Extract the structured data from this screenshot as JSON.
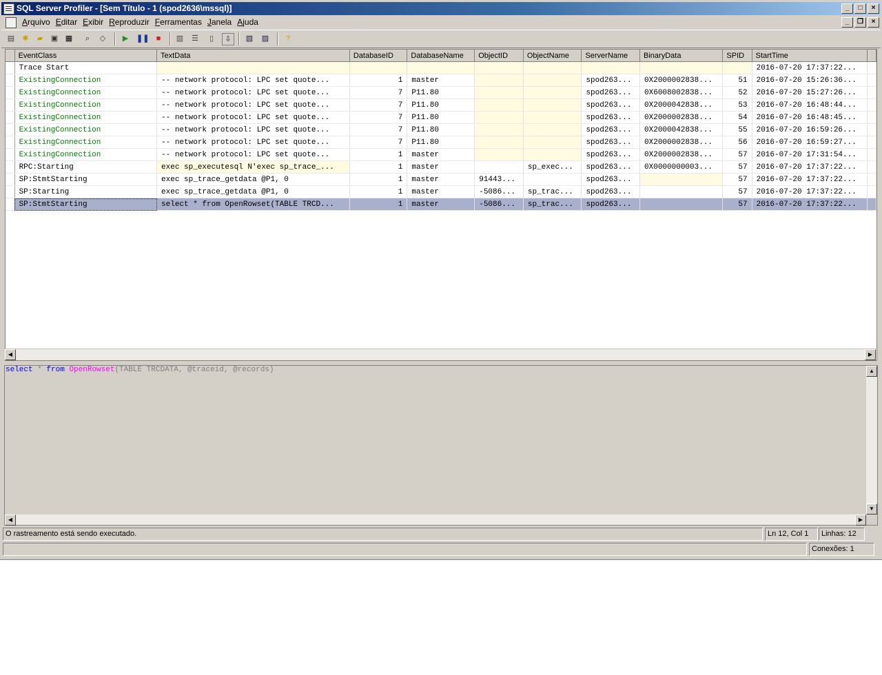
{
  "window": {
    "title": "SQL Server Profiler - [Sem Título - 1 (spod2636\\mssql)]"
  },
  "menu": {
    "items": [
      {
        "label": "Arquivo",
        "key": "A",
        "rest": "rquivo"
      },
      {
        "label": "Editar",
        "key": "E",
        "rest": "ditar"
      },
      {
        "label": "Exibir",
        "key": "E",
        "rest": "xibir"
      },
      {
        "label": "Reproduzir",
        "key": "R",
        "rest": "eproduzir"
      },
      {
        "label": "Ferramentas",
        "key": "F",
        "rest": "erramentas"
      },
      {
        "label": "Janela",
        "key": "J",
        "rest": "anela"
      },
      {
        "label": "Ajuda",
        "key": "A",
        "rest": "juda"
      }
    ]
  },
  "grid": {
    "columns": [
      "EventClass",
      "TextData",
      "DatabaseID",
      "DatabaseName",
      "ObjectID",
      "ObjectName",
      "ServerName",
      "BinaryData",
      "SPID",
      "StartTime"
    ],
    "rows": [
      [
        "Trace Start",
        "",
        "",
        "",
        "",
        "",
        "",
        "",
        "",
        "2016-07-20 17:37:22..."
      ],
      [
        "ExistingConnection",
        "-- network protocol: LPC  set quote...",
        "1",
        "master",
        "",
        "",
        "spod263...",
        "0X2000002838...",
        "51",
        "2016-07-20 15:26:36..."
      ],
      [
        "ExistingConnection",
        "-- network protocol: LPC  set quote...",
        "7",
        "P11.80",
        "",
        "",
        "spod263...",
        "0X6008002838...",
        "52",
        "2016-07-20 15:27:26..."
      ],
      [
        "ExistingConnection",
        "-- network protocol: LPC  set quote...",
        "7",
        "P11.80",
        "",
        "",
        "spod263...",
        "0X2000042838...",
        "53",
        "2016-07-20 16:48:44..."
      ],
      [
        "ExistingConnection",
        "-- network protocol: LPC  set quote...",
        "7",
        "P11.80",
        "",
        "",
        "spod263...",
        "0X2000002838...",
        "54",
        "2016-07-20 16:48:45..."
      ],
      [
        "ExistingConnection",
        "-- network protocol: LPC  set quote...",
        "7",
        "P11.80",
        "",
        "",
        "spod263...",
        "0X2000042838...",
        "55",
        "2016-07-20 16:59:26..."
      ],
      [
        "ExistingConnection",
        "-- network protocol: LPC  set quote...",
        "7",
        "P11.80",
        "",
        "",
        "spod263...",
        "0X2000002838...",
        "56",
        "2016-07-20 16:59:27..."
      ],
      [
        "ExistingConnection",
        "-- network protocol: LPC  set quote...",
        "1",
        "master",
        "",
        "",
        "spod263...",
        "0X2000002838...",
        "57",
        "2016-07-20 17:31:54..."
      ],
      [
        "RPC:Starting",
        "exec sp_executesql N'exec sp_trace_...",
        "1",
        "master",
        "",
        "sp_exec...",
        "spod263...",
        "0X0000000003...",
        "57",
        "2016-07-20 17:37:22..."
      ],
      [
        "SP:StmtStarting",
        "exec sp_trace_getdata @P1, 0",
        "1",
        "master",
        "91443...",
        "",
        "spod263...",
        "",
        "57",
        "2016-07-20 17:37:22..."
      ],
      [
        "SP:Starting",
        "exec sp_trace_getdata @P1, 0",
        "1",
        "master",
        "-5086...",
        "sp_trac...",
        "spod263...",
        "",
        "57",
        "2016-07-20 17:37:22..."
      ],
      [
        "SP:StmtStarting",
        "select * from OpenRowset(TABLE TRCD...",
        "1",
        "master",
        "-5086...",
        "sp_trac...",
        "spod263...",
        "",
        "57",
        "2016-07-20 17:37:22..."
      ]
    ],
    "selected_row": 11
  },
  "detail": {
    "p1": "select",
    "p2": " * ",
    "p3": "from",
    "p4": " ",
    "p5": "OpenRowset",
    "p6": "(TABLE TRCDATA, @traceid, @records)"
  },
  "status": {
    "message": "O rastreamento está sendo executado.",
    "position": "Ln 12, Col 1",
    "lines": "Linhas: 12",
    "connections": "Conexões: 1"
  },
  "colors": {
    "title_start": "#0a246a",
    "selection": "#a9b0cc",
    "existing_conn_text": "#008000",
    "highlight_cell": "#fffbe0"
  }
}
